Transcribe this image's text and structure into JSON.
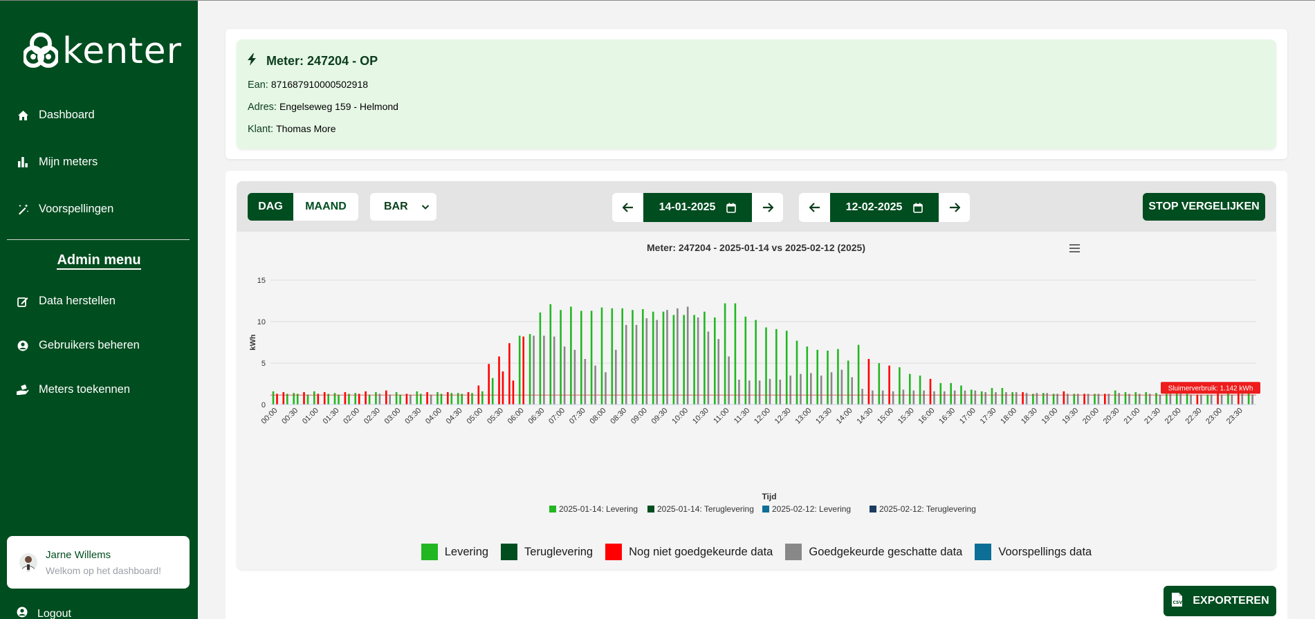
{
  "sidebar": {
    "logo_text": "kenter",
    "nav": [
      {
        "label": "Dashboard",
        "icon": "home-icon"
      },
      {
        "label": "Mijn meters",
        "icon": "bar-chart-icon"
      },
      {
        "label": "Voorspellingen",
        "icon": "magic-wand-icon"
      }
    ],
    "admin_title": "Admin menu",
    "admin_nav": [
      {
        "label": "Data herstellen",
        "icon": "edit-icon"
      },
      {
        "label": "Gebruikers beheren",
        "icon": "user-circle-icon"
      },
      {
        "label": "Meters toekennen",
        "icon": "hand-holding-icon"
      }
    ],
    "user": {
      "name": "Jarne Willems",
      "subtitle": "Welkom op het dashboard!"
    },
    "logout_label": "Logout"
  },
  "meter": {
    "title": "Meter: 247204 - OP",
    "ean_label": "Ean:",
    "ean": "871687910000502918",
    "adres_label": "Adres:",
    "adres": "Engelseweg 159 - Helmond",
    "klant_label": "Klant:",
    "klant": "Thomas More"
  },
  "toolbar": {
    "dag_label": "DAG",
    "maand_label": "MAAND",
    "chart_type": "BAR",
    "date1": "14-01-2025",
    "date2": "12-02-2025",
    "stop_label": "STOP VERGELIJKEN",
    "export_label": "EXPORTEREN"
  },
  "colors": {
    "levering": "#22b722",
    "teruglevering": "#004d1f",
    "niet_goedgekeurd": "#ff0000",
    "geschat": "#888888",
    "voorspelling": "#0d6e96",
    "brand": "#004d1f"
  },
  "status_legend": [
    {
      "label": "Levering",
      "color": "#22b722"
    },
    {
      "label": "Teruglevering",
      "color": "#004d1f"
    },
    {
      "label": "Nog niet goedgekeurde data",
      "color": "#ff0000"
    },
    {
      "label": "Goedgekeurde geschatte data",
      "color": "#888888"
    },
    {
      "label": "Voorspellings data",
      "color": "#0d6e96"
    }
  ],
  "chart_data": {
    "type": "bar",
    "title": "Meter: 247204 - 2025-01-14 vs 2025-02-12 (2025)",
    "xlabel": "Tijd",
    "ylabel": "kWh",
    "ylim": [
      0,
      15
    ],
    "yticks": [
      0,
      5,
      10,
      15
    ],
    "grid": true,
    "legend_position": "bottom",
    "tick_labels": [
      "00:00",
      "00:30",
      "01:00",
      "01:30",
      "02:00",
      "02:30",
      "03:00",
      "03:30",
      "04:00",
      "04:30",
      "05:00",
      "05:30",
      "06:00",
      "06:30",
      "07:00",
      "07:30",
      "08:00",
      "08:30",
      "09:00",
      "09:30",
      "10:00",
      "10:30",
      "11:00",
      "11:30",
      "12:00",
      "12:30",
      "13:00",
      "13:30",
      "14:00",
      "14:30",
      "15:00",
      "15:30",
      "16:00",
      "16:30",
      "17:00",
      "17:30",
      "18:00",
      "18:30",
      "19:00",
      "19:30",
      "20:00",
      "20:30",
      "21:00",
      "21:30",
      "22:00",
      "22:30",
      "23:00",
      "23:30"
    ],
    "legend": [
      {
        "name": "2025-01-14: Levering",
        "color": "#22b722"
      },
      {
        "name": "2025-01-14: Teruglevering",
        "color": "#004d1f"
      },
      {
        "name": "2025-02-12: Levering",
        "color": "#0d6e96"
      },
      {
        "name": "2025-02-12: Teruglevering",
        "color": "#1a3c5e"
      }
    ],
    "plotline": {
      "label": "Sluimerverbruik: 1.142 kWh",
      "value": 1.142
    },
    "series": [
      {
        "name": "2025-01-14: Levering",
        "values": [
          1.6,
          1.5,
          1.4,
          1.5,
          1.6,
          1.5,
          1.4,
          1.5,
          1.4,
          1.6,
          1.5,
          1.7,
          1.5,
          1.3,
          1.6,
          1.5,
          1.5,
          1.5,
          1.4,
          1.5,
          2.3,
          4.9,
          5.8,
          7.4,
          8.3,
          8.5,
          11.1,
          12.1,
          11.4,
          11.8,
          11.3,
          11.3,
          11.7,
          11.6,
          11.6,
          11.4,
          11.5,
          11.2,
          11.2,
          10.8,
          10.8,
          10.8,
          11.2,
          10.5,
          12.2,
          12.2,
          10.6,
          10.2,
          9.3,
          9.1,
          8.9,
          7.7,
          7.0,
          6.6,
          6.5,
          6.7,
          5.3,
          7.2,
          5.5,
          5.0,
          4.7,
          4.5,
          3.7,
          3.5,
          3.1,
          2.6,
          2.6,
          2.3,
          1.8,
          1.6,
          2.0,
          2.0,
          1.5,
          1.5,
          1.3,
          1.4,
          1.3,
          1.6,
          1.3,
          1.3,
          1.3,
          1.3,
          1.7,
          1.5,
          1.5,
          1.5,
          1.4,
          1.3,
          2.3,
          1.3,
          1.2,
          1.2,
          1.4,
          1.6,
          1.6,
          1.5
        ],
        "status": [
          "g",
          "r",
          "g",
          "r",
          "g",
          "r",
          "g",
          "r",
          "g",
          "r",
          "g",
          "r",
          "g",
          "r",
          "g",
          "r",
          "g",
          "r",
          "g",
          "r",
          "r",
          "r",
          "r",
          "r",
          "g",
          "g",
          "g",
          "g",
          "g",
          "g",
          "g",
          "g",
          "g",
          "g",
          "g",
          "g",
          "g",
          "g",
          "g",
          "g",
          "g",
          "g",
          "g",
          "g",
          "g",
          "g",
          "g",
          "g",
          "g",
          "g",
          "g",
          "g",
          "g",
          "g",
          "g",
          "g",
          "g",
          "g",
          "r",
          "g",
          "r",
          "g",
          "g",
          "g",
          "r",
          "g",
          "g",
          "g",
          "g",
          "g",
          "g",
          "g",
          "g",
          "r",
          "g",
          "g",
          "g",
          "r",
          "g",
          "r",
          "g",
          "r",
          "g",
          "g",
          "g",
          "g",
          "g",
          "g",
          "g",
          "g",
          "r",
          "g",
          "r",
          "g",
          "r",
          "g",
          "r",
          "g"
        ]
      },
      {
        "name": "2025-02-12: Levering",
        "values": [
          1.3,
          1.3,
          1.3,
          1.2,
          1.3,
          1.3,
          1.2,
          1.3,
          1.3,
          1.2,
          1.3,
          1.2,
          1.2,
          1.2,
          1.3,
          1.2,
          1.3,
          1.4,
          1.3,
          1.4,
          1.6,
          3.2,
          4.0,
          2.9,
          8.2,
          8.3,
          8.3,
          8.2,
          7.0,
          6.6,
          5.5,
          4.7,
          3.9,
          6.6,
          9.6,
          9.6,
          10.4,
          10.2,
          11.4,
          11.6,
          11.8,
          10.5,
          8.8,
          7.9,
          5.8,
          3.0,
          2.9,
          2.9,
          3.1,
          3.0,
          3.5,
          3.7,
          3.8,
          3.5,
          3.9,
          4.2,
          3.3,
          1.9,
          1.7,
          1.7,
          1.6,
          1.8,
          1.7,
          1.7,
          1.6,
          1.6,
          1.7,
          1.7,
          1.7,
          1.5,
          1.5,
          1.5,
          1.5,
          1.4,
          1.4,
          1.4,
          1.3,
          1.3,
          1.3,
          1.3,
          1.3,
          1.3,
          1.4,
          1.3,
          1.3,
          1.3,
          1.2,
          1.3,
          1.3,
          1.2,
          1.2,
          1.2,
          1.2,
          1.2,
          1.3,
          1.2
        ],
        "status": [
          "r",
          "g",
          "g",
          "g",
          "r",
          "g",
          "g",
          "g",
          "r",
          "g",
          "e",
          "e",
          "g",
          "e",
          "g",
          "e",
          "g",
          "g",
          "g",
          "g",
          "g",
          "g",
          "r",
          "r",
          "r",
          "e",
          "e",
          "e",
          "e",
          "e",
          "e",
          "e",
          "e",
          "e",
          "e",
          "e",
          "e",
          "e",
          "e",
          "e",
          "e",
          "e",
          "e",
          "e",
          "e",
          "e",
          "e",
          "e",
          "e",
          "e",
          "e",
          "e",
          "e",
          "e",
          "e",
          "e",
          "e",
          "e",
          "e",
          "e",
          "e",
          "e",
          "e",
          "e",
          "e",
          "e",
          "e",
          "e",
          "e",
          "e",
          "e",
          "e",
          "e",
          "e",
          "e",
          "e",
          "e",
          "e",
          "e",
          "e",
          "e",
          "e",
          "e",
          "e",
          "e",
          "e",
          "e",
          "e",
          "e",
          "e",
          "e",
          "e",
          "e",
          "e",
          "e",
          "e"
        ]
      }
    ]
  }
}
